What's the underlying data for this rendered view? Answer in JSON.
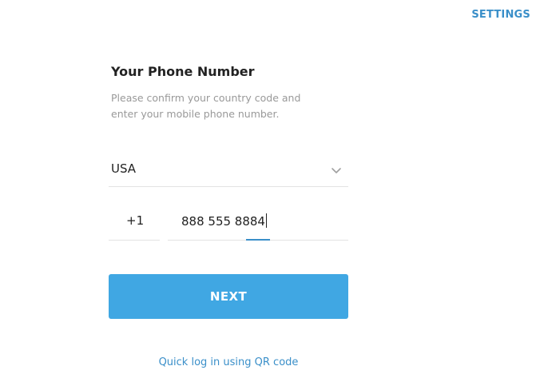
{
  "header": {
    "settings_label": "SETTINGS"
  },
  "login": {
    "title": "Your Phone Number",
    "subtitle_line1": "Please confirm your country code and",
    "subtitle_line2": "enter your mobile phone number.",
    "country": {
      "selected": "USA",
      "icon": "chevron-down-icon"
    },
    "country_code": "+1",
    "phone_number": "888 555 8884",
    "next_label": "NEXT",
    "qr_link_label": "Quick log in using QR code"
  },
  "colors": {
    "accent": "#40a7e3",
    "link": "#3a8fc9",
    "muted_text": "#999999",
    "divider": "#e3e3e3"
  }
}
